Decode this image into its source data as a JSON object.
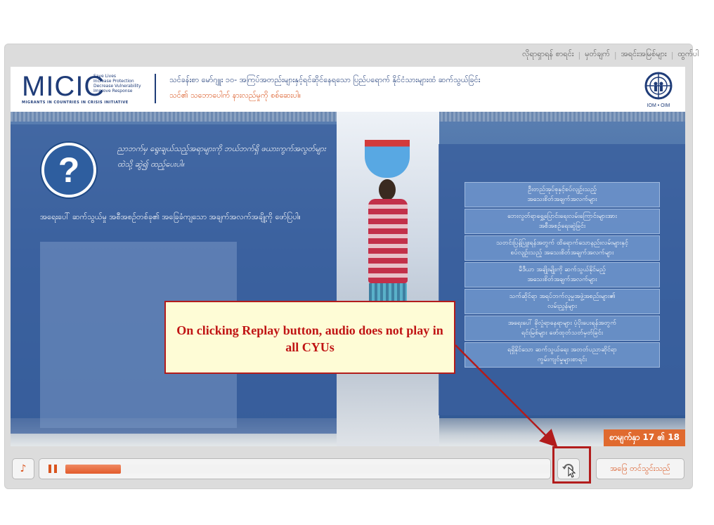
{
  "topnav": {
    "items": [
      "လိုရာရှာရန် စာရင်း",
      "မှတ်ချက်",
      "အရင်းအမြစ်များ",
      "ထွက်ပါ"
    ]
  },
  "header": {
    "logo": "MICIC",
    "logo_tagline": "Save Lives\nIncrease Protection\nDecrease Vulnerability\nImprove Response",
    "logo_sub": "MIGRANTS IN COUNTRIES IN CRISIS INITIATIVE",
    "course_title": "သင်ခန်းစာ မော်ဂျူး ၁၀- အကြပ်အတည်းများနှင့်ရင်ဆိုင်နေရသော ပြည်ပရောက် နိုင်ငံသားများထံ ဆက်သွယ်ခြင်း",
    "course_subtitle": "သင်၏ သဘောပေါက် နားလည်မှုကို စစ်ဆေးပါ။",
    "iom_label": "IOM • OIM"
  },
  "stage": {
    "question_mark": "?",
    "instruction": "ညာဘက်မှ ရွေးချယ်သည့်အရာများကို ဘယ်ဘက်ရှိ ဖယားကွက်အလွတ်များထဲသို့ ဆွဲ၍ ထည့်ပေးပါ။",
    "panel_text": "အရေးပေါ် ဆက်သွယ်မှု အစီအစဉ်တစ်ခု၏ အခြေခံကျသော အချက်အလက်အချို့ကို ဖော်ပြပါ။",
    "topics": [
      "ဦးတည်အုပ်စုနှင့်စပ်လျဉ်းသည့်\nအသေးစိတ်အချက်အလက်များ",
      "ဘေးလွတ်ရာရွှေ့ပြောင်းရေးလမ်းကြောင်းများအား\nအစီအစဉ်ရေးဆွဲခြင်း",
      "သတင်းပြန့်ပြူးရန်အတွက် ထိရောက်သောနည်းလမ်းများနှင့်\nစပ်လျဉ်းသည့် အသေးစိတ်အချက်အလက်များ",
      "မီဒီယာ အချိုးမျိုးကို ဆက်သွယ်နိုင်မည့်\nအသေးစိတ်အချက်အလက်များ",
      "သက်ဆိုင်ရာ အရပ်ဘက်လူမှုအဖွဲ့အစည်းများ၏\nလမ်းညွှန်များ",
      "အရေးပေါ် ခိုလှုံရာနေရာများ ပံ့ပိုးပေးရန်အတွက်\nရင်းမြစ်များ ဖော်ထုတ်သတ်မှတ်ခြင်း",
      "ရရှိနိုင်သော ဆက်သွယ်ရေး အတတ်ပညာဆိုင်ရာ\nကွမ်းကျင်မှုများစာရင်း"
    ],
    "page_counter": "စာမျက်နှာ 17 ၏ 18"
  },
  "callout": {
    "text": "On clicking Replay button, audio does not play in all CYUs"
  },
  "controls": {
    "volume_icon": "♪",
    "progress_fraction": 0.115,
    "submit_label": "အဖြေ တင်သွင်းသည်"
  },
  "colors": {
    "accent": "#d9541e",
    "brand": "#1f3c78",
    "callout_border": "#b21c1c",
    "callout_text": "#c01414"
  }
}
